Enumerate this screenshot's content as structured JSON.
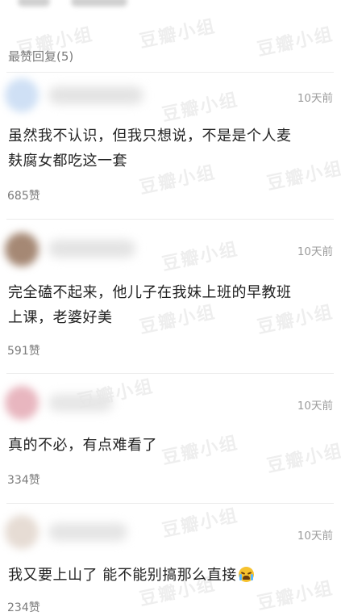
{
  "section": {
    "title": "最赞回复(5)"
  },
  "watermark": "豆瓣小组",
  "comments": [
    {
      "time": "10天前",
      "lines": [
        "虽然我不认识，但我只想说，不是是个人麦",
        "麸腐女都吃这一套"
      ],
      "likes": "685赞",
      "avatar_color": "#cfe0f5",
      "name_color": "#e3e3e3"
    },
    {
      "time": "10天前",
      "lines": [
        "完全磕不起来，他儿子在我妹上班的早教班",
        "上课，老婆好美"
      ],
      "likes": "591赞",
      "avatar_color": "#a58874",
      "name_color": "#e3e3e3"
    },
    {
      "time": "10天前",
      "lines": [
        "真的不必，有点难看了"
      ],
      "likes": "334赞",
      "avatar_color": "#e8b6bf",
      "name_color": "#e6e6e6"
    },
    {
      "time": "10天前",
      "lines": [
        "我又要上山了 能不能别搞那么直接"
      ],
      "likes": "234赞",
      "avatar_color": "#e6dcd4",
      "name_color": "#e4e4e4",
      "trailing_icon": "crying-face-icon"
    }
  ]
}
